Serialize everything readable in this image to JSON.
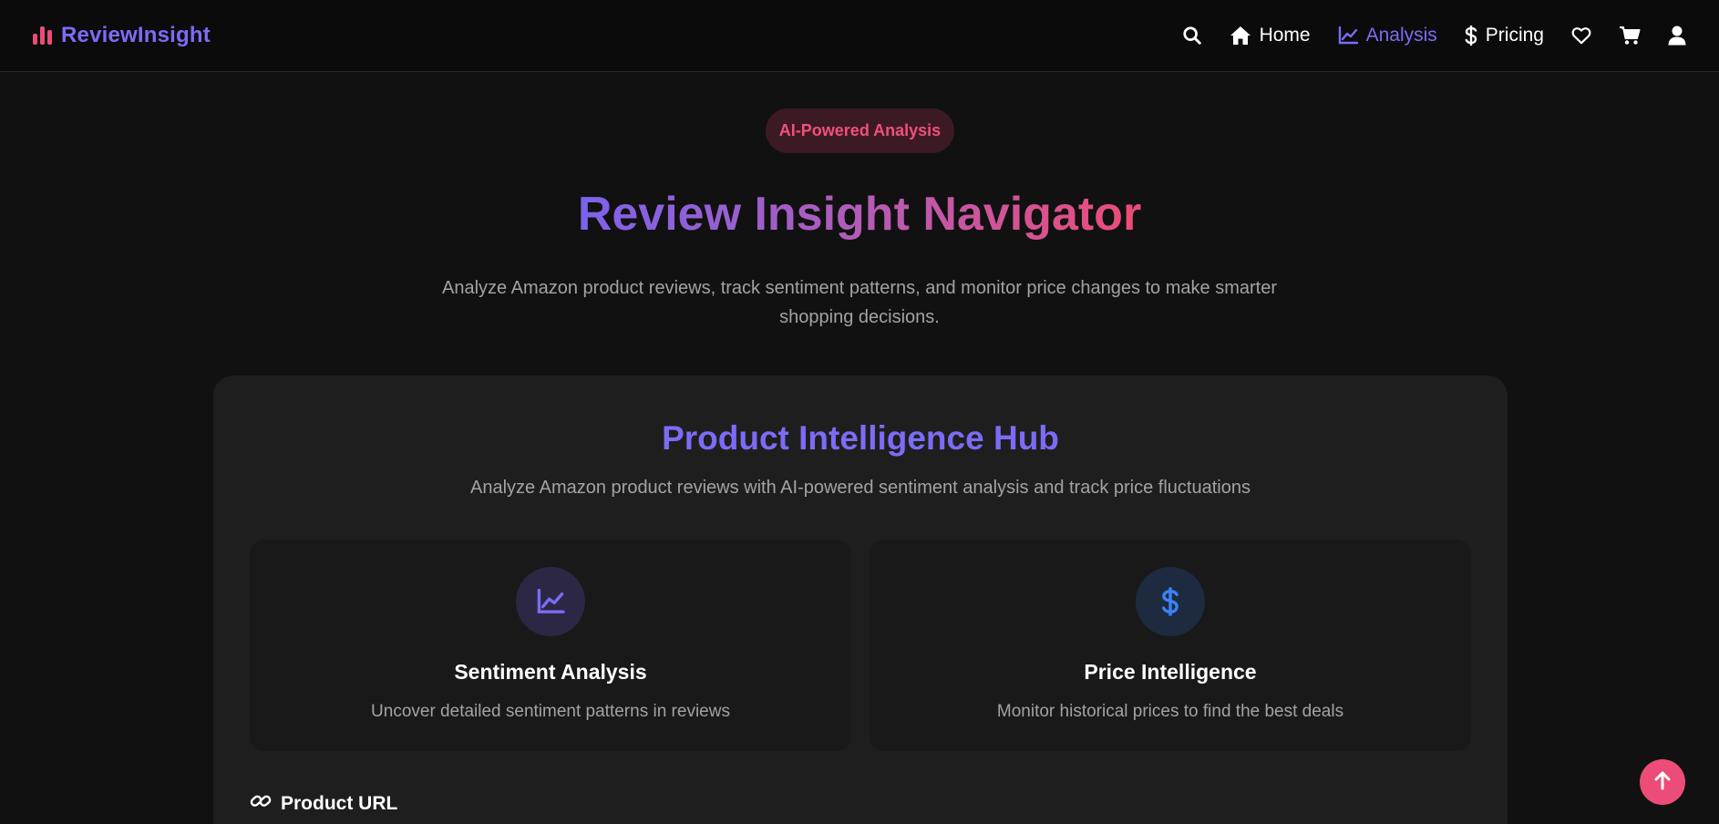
{
  "brand": {
    "name": "ReviewInsight",
    "icon": "bar-chart-icon",
    "color": "#7b6cf6",
    "icon_color": "#ec4c79"
  },
  "nav": {
    "search_icon": "search-icon",
    "items": [
      {
        "label": "Home",
        "icon": "home-icon",
        "active": false
      },
      {
        "label": "Analysis",
        "icon": "line-chart-icon",
        "active": true
      },
      {
        "label": "Pricing",
        "icon": "dollar-icon",
        "active": false
      }
    ],
    "wishlist_icon": "heart-icon",
    "cart_icon": "cart-icon",
    "user_icon": "user-icon"
  },
  "hero": {
    "badge": "AI-Powered Analysis",
    "title": "Review Insight Navigator",
    "subtitle_line1": "Analyze Amazon product reviews, track sentiment patterns, and monitor price changes to make smarter",
    "subtitle_line2": "shopping decisions."
  },
  "hub": {
    "title": "Product Intelligence Hub",
    "subtitle": "Analyze Amazon product reviews with AI-powered sentiment analysis and track price fluctuations",
    "cards": [
      {
        "title": "Sentiment Analysis",
        "description": "Uncover detailed sentiment patterns in reviews",
        "icon": "line-chart-icon",
        "icon_color": "#7b6cf6"
      },
      {
        "title": "Price Intelligence",
        "description": "Monitor historical prices to find the best deals",
        "icon": "dollar-icon",
        "icon_color": "#3b82f6"
      }
    ],
    "url_label": "Product URL",
    "url_icon": "link-icon"
  },
  "scroll_top_icon": "arrow-up-icon",
  "colors": {
    "accent": "#7b6cf6",
    "pink": "#ec4c78",
    "background": "#111111",
    "panel": "#1e1e1e"
  }
}
